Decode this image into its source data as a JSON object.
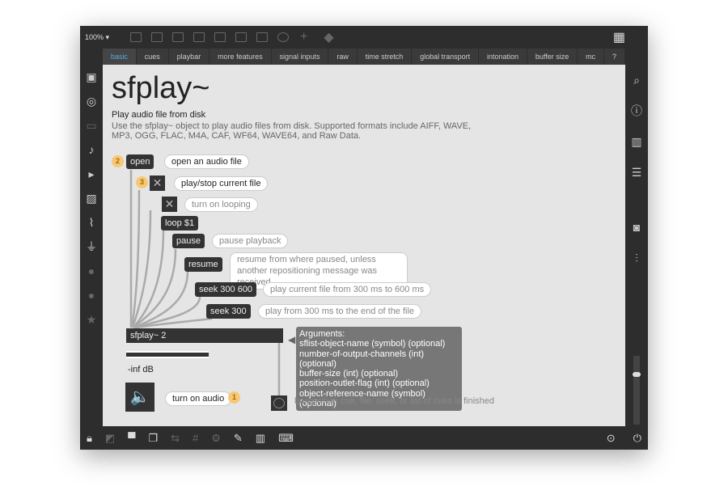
{
  "toolbar": {
    "zoom": "100%"
  },
  "tabs": [
    "basic",
    "cues",
    "playbar",
    "more features",
    "signal inputs",
    "raw",
    "time stretch",
    "global transport",
    "intonation",
    "buffer size",
    "mc",
    "?"
  ],
  "patch": {
    "title": "sfplay~",
    "subtitle": "Play audio file from disk",
    "description": "Use the sfplay~ object to play audio files from disk. Supported formats include AIFF, WAVE, MP3, OGG, FLAC, M4A, CAF, WF64, WAVE64, and Raw Data.",
    "objects": {
      "open": "open",
      "loop": "loop $1",
      "pause": "pause",
      "resume": "resume",
      "seek1": "seek 300 600",
      "seek2": "seek 300",
      "sfplay": "sfplay~ 2",
      "meter": "-inf dB"
    },
    "comments": {
      "open": "open an audio file",
      "play": "play/stop current file",
      "loop": "turn on looping",
      "pause": "pause playback",
      "resume": "resume from where paused, unless another repositioning message was received",
      "seek1": "play current file from 300 ms to 600 ms",
      "seek2": "play from 300 ms to the end of the file",
      "audio": "turn on audio",
      "bang": "bang when cue, file, seek, or list of cues is finished"
    },
    "badges": [
      "2",
      "3",
      "1"
    ],
    "arguments": {
      "heading": "Arguments:",
      "items": [
        "sflist-object-name (symbol) (optional)",
        "number-of-output-channels (int) (optional)",
        "buffer-size (int) (optional)",
        "position-outlet-flag (int) (optional)",
        "object-reference-name (symbol) (optional)"
      ]
    }
  },
  "colors": {
    "accent": "#59a9e8",
    "badge": "#f7c873",
    "object": "#333333"
  }
}
